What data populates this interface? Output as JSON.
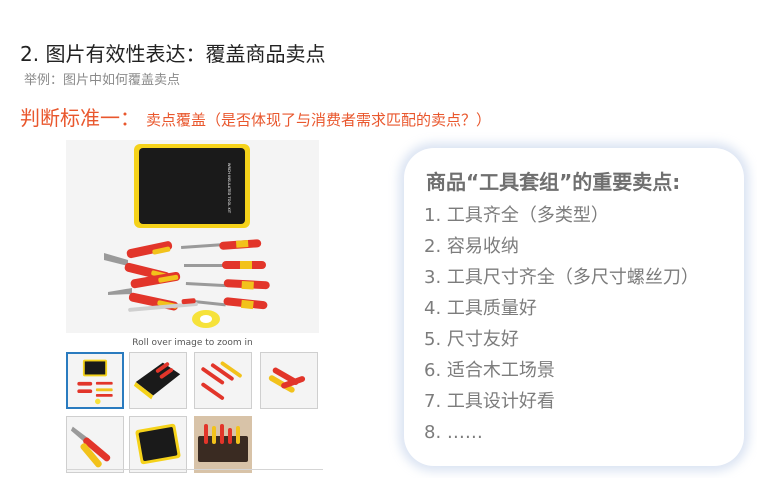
{
  "slide": {
    "title": "2. 图片有效性表达：覆盖商品卖点",
    "subtitle": "举例：图片中如何覆盖卖点",
    "criteria_heading": "判断标准一：",
    "criteria_text": "卖点覆盖（是否体现了与消费者需求匹配的卖点？）"
  },
  "product": {
    "case_label": "WRCH INSULATED TOOL KIT",
    "zoom_hint": "Roll over image to zoom in",
    "thumbnail_count": 7
  },
  "selling_points": {
    "title": "商品“工具套组”的重要卖点:",
    "items": [
      "1. 工具齐全（多类型）",
      "2. 容易收纳",
      "3. 工具尺寸齐全（多尺寸螺丝刀）",
      "4. 工具质量好",
      "5. 尺寸友好",
      "6. 适合木工场景",
      "7. 工具设计好看",
      "8. ……"
    ]
  },
  "colors": {
    "accent": "#e9572d",
    "case_black": "#1a1a1a",
    "case_yellow": "#f5d21a",
    "tool_red": "#e2352a",
    "tool_yellow": "#f2c21b",
    "thumb_active_border": "#2a7bbf",
    "card_shadow": "#cddaee"
  }
}
